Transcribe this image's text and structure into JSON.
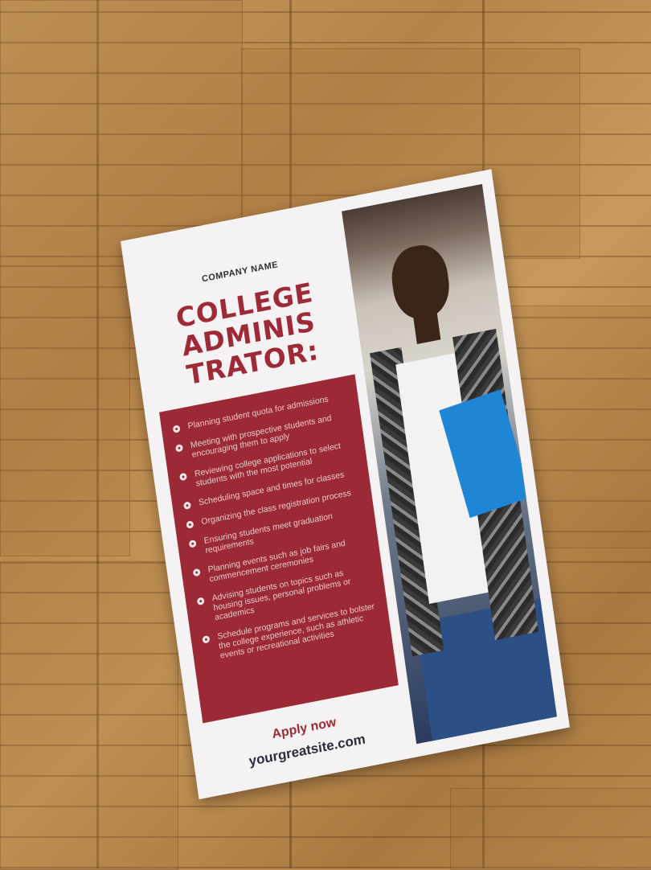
{
  "flyer": {
    "company_name": "COMPANY NAME",
    "title_lines": [
      "COLLEGE",
      "ADMINIS",
      "TRATOR:"
    ],
    "duties": [
      "Planning student quota for admissions",
      "Meeting with prospective students and encouraging them to apply",
      "Reviewing college applications to select students with the most potential",
      "Scheduling space and times for classes",
      "Organizing the class registration process",
      "Ensuring students meet graduation requirements",
      "Planning events such as job fairs and commencement ceremonies",
      "Advising students on topics such as housing issues, personal problems or academics",
      "Schedule programs and services to bolster the college experience, such as athletic events or recreational activities"
    ],
    "apply_label": "Apply now",
    "website": "yourgreatsite.com"
  },
  "colors": {
    "accent": "#9c2a36",
    "paper": "#f4f2f3",
    "floor": "#b98a4e"
  }
}
